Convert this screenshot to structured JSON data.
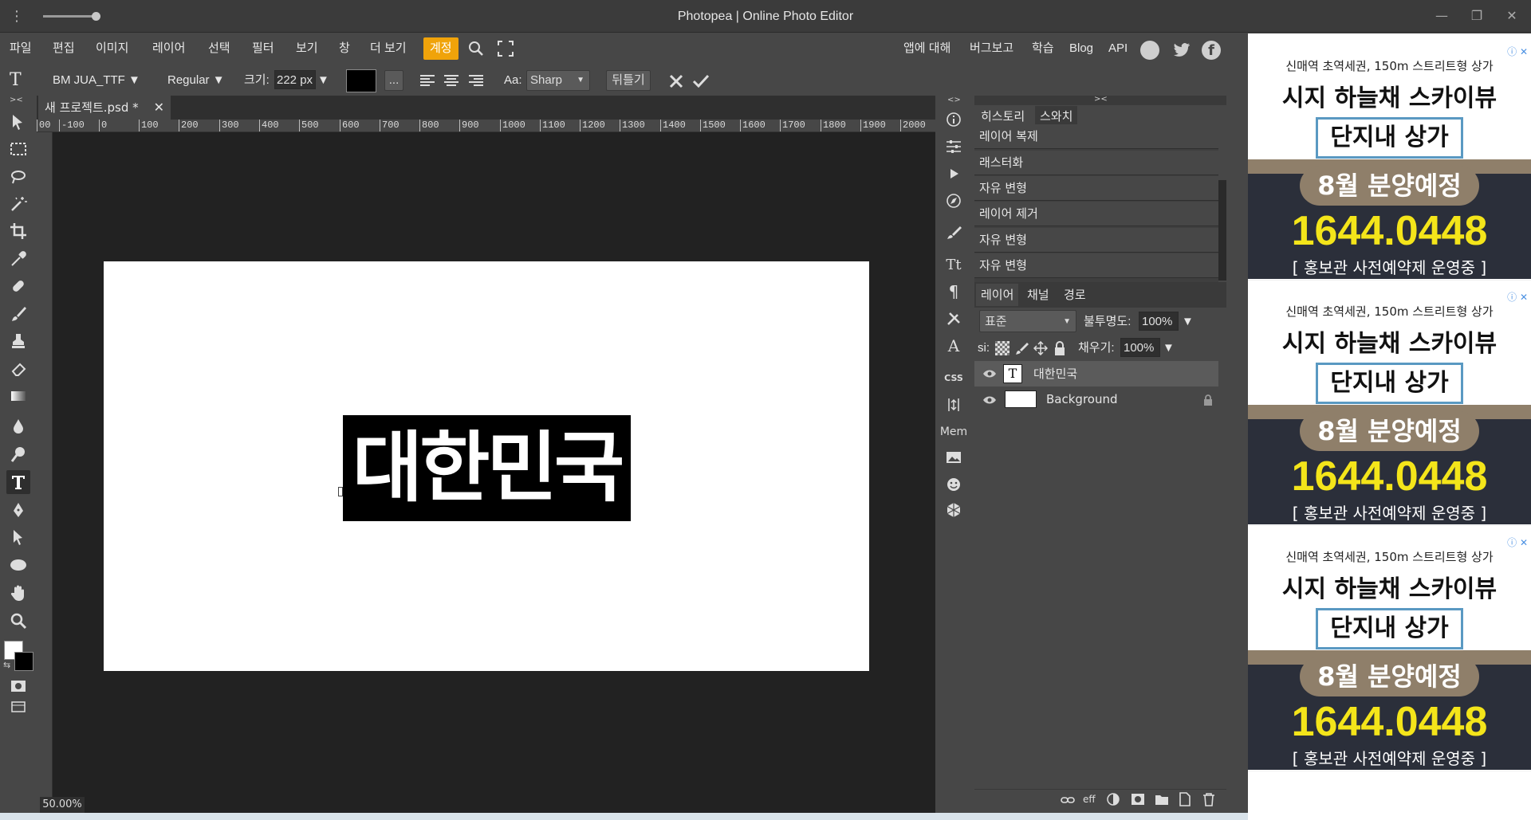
{
  "window": {
    "title": "Photopea | Online Photo Editor",
    "minimize": "—",
    "restore": "❐",
    "close": "✕"
  },
  "menu": {
    "items": [
      "파일",
      "편집",
      "이미지",
      "레이어",
      "선택",
      "필터",
      "보기",
      "창",
      "더 보기"
    ],
    "account": "계정",
    "right": [
      "앱에 대해",
      "버그보고",
      "학습",
      "Blog",
      "API"
    ]
  },
  "options": {
    "font": "BM JUA_TTF ▼",
    "style": "Regular ▼",
    "size_label": "크기:",
    "size_value": "222 px",
    "more": "...",
    "aa_label": "Aa:",
    "aa_value": "Sharp",
    "warp": "뒤틀기"
  },
  "document": {
    "tab": "새 프로젝트.psd *",
    "ruler_h": [
      "00",
      "-100",
      "0",
      "100",
      "200",
      "300",
      "400",
      "500",
      "600",
      "700",
      "800",
      "900",
      "1000",
      "1100",
      "1200",
      "1300",
      "1400",
      "1500",
      "1600",
      "1700",
      "1800",
      "1900",
      "2000"
    ],
    "text": "대한민국",
    "zoom": "50.00%"
  },
  "history": {
    "tabs": [
      "히스토리",
      "스와치"
    ],
    "items": [
      "레이어 복제",
      "래스터화",
      "자유 변형",
      "레이어 제거",
      "자유 변형",
      "자유 변형"
    ]
  },
  "layers": {
    "tabs": [
      "레이어",
      "채널",
      "경로"
    ],
    "blend": "표준",
    "opacity_label": "불투명도:",
    "opacity": "100%",
    "lock_label": "si:",
    "fill_label": "채우기:",
    "fill": "100%",
    "rows": [
      {
        "name": "대한민국",
        "thumb": "T"
      },
      {
        "name": "Background"
      }
    ]
  },
  "side_strip": {
    "css": "CSS",
    "mem": "Mem"
  },
  "ad": {
    "small": "신매역 초역세권, 150m 스트리트형 상가",
    "big": "시지 하늘채 스카이뷰",
    "box": "단지내 상가",
    "pill": "8월 분양예정",
    "phone": "1644.0448",
    "note": "[ 홍보관 사전예약제 운영중 ]",
    "info": "ⓘ ✕"
  },
  "colors": {
    "accent": "#f0a30a",
    "panel": "#474747",
    "workspace": "#222222"
  }
}
